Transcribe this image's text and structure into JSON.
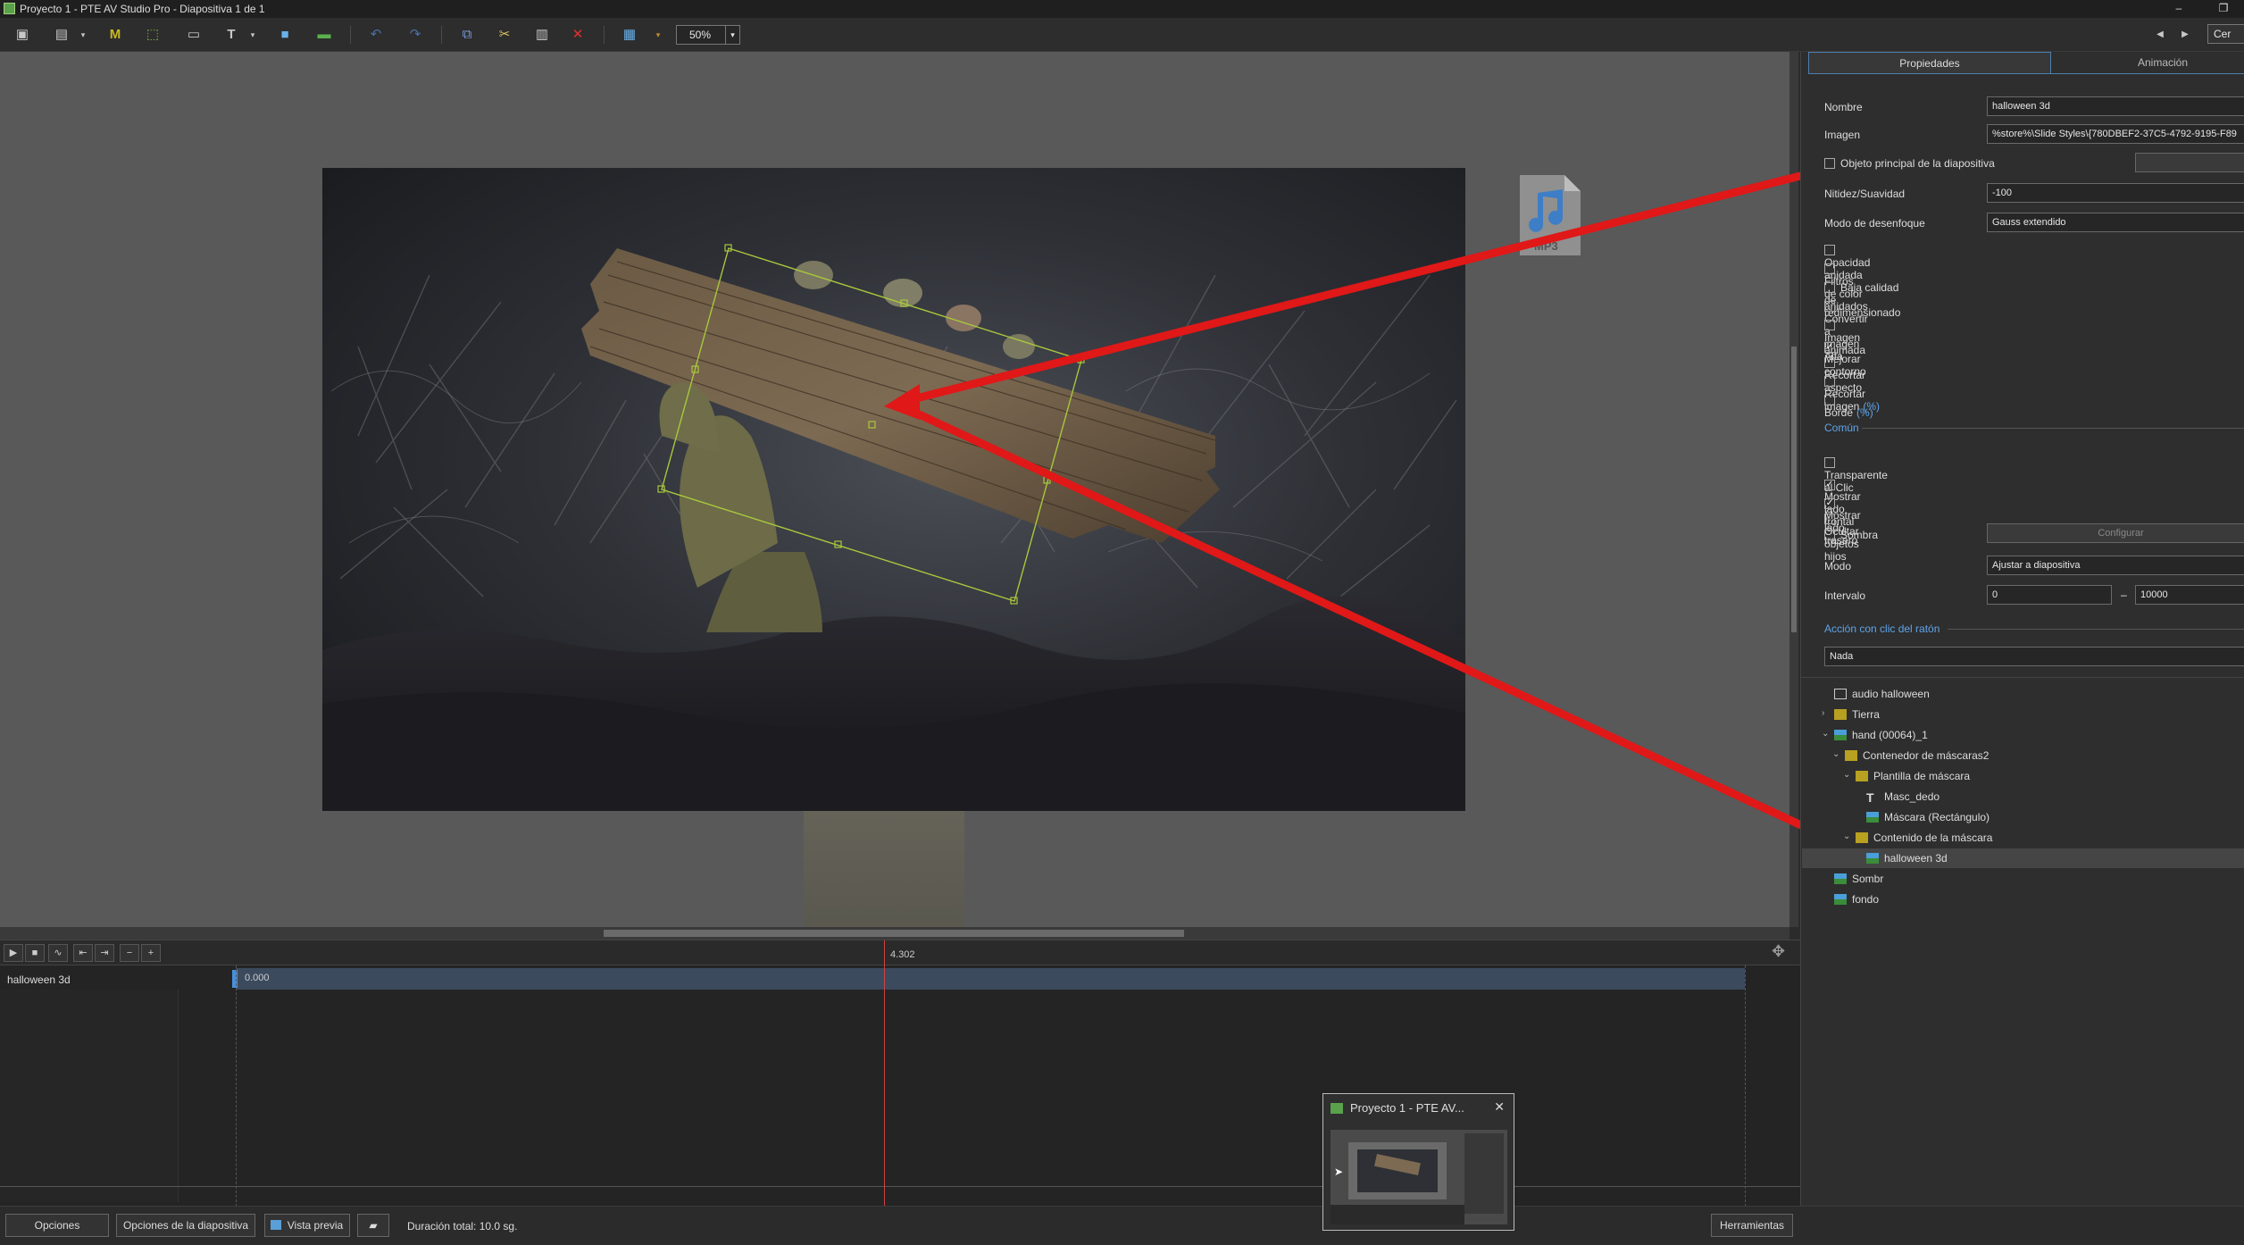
{
  "window": {
    "title": "Proyecto 1 - PTE AV Studio Pro - Diapositiva 1 de 1",
    "minimize": "–",
    "restore": "❐",
    "partial_button": "Cer"
  },
  "toolbar": {
    "zoom_value": "50%",
    "tools": [
      "projector-icon",
      "slide-options-icon",
      "mask-container-icon",
      "frame-icon",
      "text-box-icon",
      "text-icon",
      "rectangle-icon",
      "image-icon",
      "undo-icon",
      "redo-icon",
      "copy-icon",
      "cut-icon",
      "paste-icon",
      "delete-icon",
      "grid-icon"
    ]
  },
  "canvas": {
    "selected_object": "halloween 3d",
    "mp3_label": "MP3"
  },
  "timeline": {
    "cursor_time": "4.302",
    "track_name": "halloween 3d",
    "track_start": "0.000"
  },
  "statusbar": {
    "options": "Opciones",
    "slide_options": "Opciones de la diapositiva",
    "preview": "Vista previa",
    "duration": "Duración total: 10.0 sg.",
    "tools": "Herramientas"
  },
  "panel": {
    "tabs": [
      "Propiedades",
      "Animación"
    ],
    "nombre_label": "Nombre",
    "nombre_value": "halloween 3d",
    "imagen_label": "Imagen",
    "imagen_value": "%store%\\Slide Styles\\{780DBEF2-37C5-4792-9195-F89",
    "main_object_label": "Objeto principal de la diapositiva",
    "nitidez_label": "Nitidez/Suavidad",
    "nitidez_value": "-100",
    "blur_label": "Modo de desenfoque",
    "blur_value": "Gauss extendido",
    "checks1": [
      {
        "label": "Opacidad anidada",
        "checked": false,
        "pct": ""
      },
      {
        "label": "Filtros de color anidados",
        "checked": false,
        "pct": ""
      },
      {
        "label": "Baja calidad de redimensionado",
        "checked": false,
        "pct": ""
      },
      {
        "label": "Convertir a imagen Alfa",
        "checked": false,
        "pct": ""
      },
      {
        "label": "Imagen animada",
        "checked": false,
        "pct": ""
      },
      {
        "label": "Mejorar contorno",
        "checked": true,
        "pct": ""
      },
      {
        "label": "Recortar aspecto",
        "checked": false,
        "pct": ""
      },
      {
        "label": "Recortar imagen",
        "checked": false,
        "pct": "(%)"
      },
      {
        "label": "Borde",
        "checked": false,
        "pct": "(%)"
      }
    ],
    "common_section": "Común",
    "checks2": [
      {
        "label": "Transparente al Clic",
        "checked": false
      },
      {
        "label": "Mostrar lado frontal",
        "checked": true
      },
      {
        "label": "Mostrar lado trasero",
        "checked": true
      },
      {
        "label": "Ocultar objetos hijos",
        "checked": false
      }
    ],
    "sombra_label": "Sombra",
    "configurar": "Configurar",
    "modo_label": "Modo",
    "modo_value": "Ajustar a diapositiva",
    "intervalo_label": "Intervalo",
    "intervalo_from": "0",
    "intervalo_dash": "–",
    "intervalo_to": "10000",
    "mouse_section": "Acción con clic del ratón",
    "mouse_value": "Nada"
  },
  "tree": [
    {
      "label": "audio halloween",
      "icon": "audio-icon"
    },
    {
      "label": "Tierra",
      "icon": "mask-container-icon"
    },
    {
      "label": "hand (00064)_1",
      "icon": "image-icon"
    },
    {
      "label": "Contenedor de máscaras2",
      "icon": "mask-container-icon"
    },
    {
      "label": "Plantilla de máscara",
      "icon": "mask-template-icon"
    },
    {
      "label": "Masc_dedo",
      "icon": "text-icon"
    },
    {
      "label": "Máscara (Rectángulo)",
      "icon": "image-icon"
    },
    {
      "label": "Contenido de la máscara",
      "icon": "mask-content-icon"
    },
    {
      "label": "halloween 3d",
      "icon": "image-icon"
    },
    {
      "label": "Sombr",
      "icon": "image-icon"
    },
    {
      "label": "fondo",
      "icon": "image-icon"
    }
  ],
  "popup": {
    "title": "Proyecto 1 - PTE AV...",
    "close": "✕"
  },
  "colors": {
    "accent": "#5fa4e8",
    "annotation_arrow": "#e01818",
    "selection_frame": "#a8c83c"
  }
}
